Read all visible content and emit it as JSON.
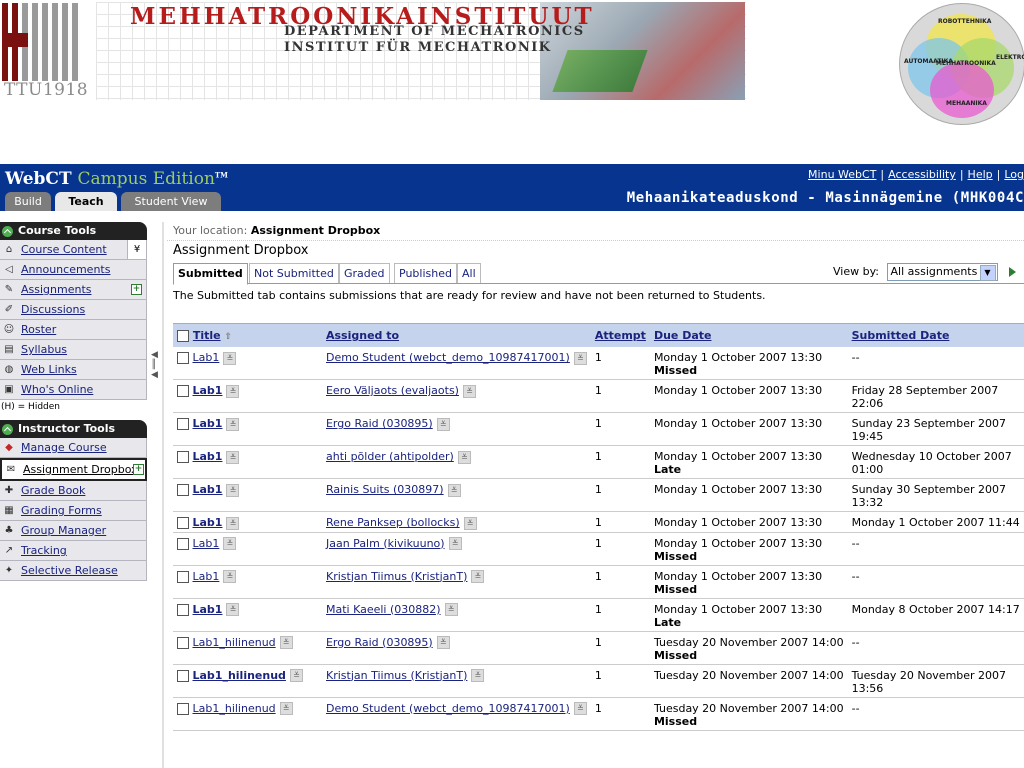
{
  "banner": {
    "ttu": "TTU1918",
    "title": "MEHHATROONIKAINSTITUUT",
    "sub1": "DEPARTMENT OF MECHATRONICS",
    "sub2": "INSTITUT FÜR MECHATRONIK",
    "venn": {
      "top": "ROBOTTEHNIKA",
      "left": "AUTOMAATIKA",
      "right": "ELEKTRONIKA",
      "center": "MEHHATROONIKA",
      "bottom": "MEHAANIKA"
    }
  },
  "header": {
    "logo_main": "WebCT",
    "logo_edition": "Campus Edition",
    "logo_tm": "TM",
    "links": [
      "Minu WebCT",
      "Accessibility",
      "Help",
      "Log"
    ],
    "course_title": "Mehaanikateaduskond - Masinnägemine (MHK004C",
    "tabs": [
      "Build",
      "Teach",
      "Student View"
    ]
  },
  "sidebar": {
    "course_tools_title": "Course Tools",
    "course_tools": [
      {
        "label": "Course Content",
        "icon": "home-icon"
      },
      {
        "label": "Announcements",
        "icon": "megaphone-icon"
      },
      {
        "label": "Assignments",
        "icon": "assignment-icon"
      },
      {
        "label": "Discussions",
        "icon": "discussion-icon"
      },
      {
        "label": "Roster",
        "icon": "roster-icon"
      },
      {
        "label": "Syllabus",
        "icon": "syllabus-icon"
      },
      {
        "label": "Web Links",
        "icon": "globe-icon"
      },
      {
        "label": "Who's Online",
        "icon": "person-icon"
      }
    ],
    "hidden_note": "(H) = Hidden",
    "instructor_tools_title": "Instructor Tools",
    "instructor_tools": [
      {
        "label": "Manage Course",
        "icon": "manage-icon"
      },
      {
        "label": "Assignment Dropbox",
        "icon": "dropbox-icon"
      },
      {
        "label": "Grade Book",
        "icon": "gradebook-icon"
      },
      {
        "label": "Grading Forms",
        "icon": "grading-forms-icon"
      },
      {
        "label": "Group Manager",
        "icon": "group-icon"
      },
      {
        "label": "Tracking",
        "icon": "tracking-icon"
      },
      {
        "label": "Selective Release",
        "icon": "release-icon"
      }
    ]
  },
  "main": {
    "location_label": "Your location:",
    "location_value": "Assignment Dropbox",
    "page_title": "Assignment Dropbox",
    "subtabs": [
      "Submitted",
      "Not Submitted",
      "Graded",
      "Published",
      "All"
    ],
    "viewby_label": "View by:",
    "viewby_value": "All assignments",
    "description": "The Submitted tab contains submissions that are ready for review and have not been returned to Students.",
    "columns": [
      "Title",
      "Assigned to",
      "Attempt",
      "Due Date",
      "Submitted Date"
    ],
    "rows": [
      {
        "title": "Lab1",
        "bold": false,
        "assigned": "Demo Student (webct_demo_10987417001)",
        "attempt": "1",
        "due": "Monday 1 October 2007 13:30",
        "status": "Missed",
        "submitted": "--"
      },
      {
        "title": "Lab1",
        "bold": true,
        "assigned": "Eero Väljaots (evaljaots)",
        "attempt": "1",
        "due": "Monday 1 October 2007 13:30",
        "status": "",
        "submitted": "Friday 28 September 2007 22:06"
      },
      {
        "title": "Lab1",
        "bold": true,
        "assigned": "Ergo Raid (030895)",
        "attempt": "1",
        "due": "Monday 1 October 2007 13:30",
        "status": "",
        "submitted": "Sunday 23 September 2007 19:45"
      },
      {
        "title": "Lab1",
        "bold": true,
        "assigned": "ahti põlder (ahtipolder)",
        "attempt": "1",
        "due": "Monday 1 October 2007 13:30",
        "status": "Late",
        "submitted": "Wednesday 10 October 2007 01:00"
      },
      {
        "title": "Lab1",
        "bold": true,
        "assigned": "Rainis Suits (030897)",
        "attempt": "1",
        "due": "Monday 1 October 2007 13:30",
        "status": "",
        "submitted": "Sunday 30 September 2007 13:32"
      },
      {
        "title": "Lab1",
        "bold": true,
        "assigned": "Rene Panksep (bollocks)",
        "attempt": "1",
        "due": "Monday 1 October 2007 13:30",
        "status": "",
        "submitted": "Monday 1 October 2007 11:44"
      },
      {
        "title": "Lab1",
        "bold": false,
        "assigned": "Jaan Palm (kivikuuno)",
        "attempt": "1",
        "due": "Monday 1 October 2007 13:30",
        "status": "Missed",
        "submitted": "--"
      },
      {
        "title": "Lab1",
        "bold": false,
        "assigned": "Kristjan Tiimus (KristjanT)",
        "attempt": "1",
        "due": "Monday 1 October 2007 13:30",
        "status": "Missed",
        "submitted": "--"
      },
      {
        "title": "Lab1",
        "bold": true,
        "assigned": "Mati Kaeeli (030882)",
        "attempt": "1",
        "due": "Monday 1 October 2007 13:30",
        "status": "Late",
        "submitted": "Monday 8 October 2007 14:17"
      },
      {
        "title": "Lab1_hilinenud",
        "bold": false,
        "assigned": "Ergo Raid (030895)",
        "attempt": "1",
        "due": "Tuesday 20 November 2007 14:00",
        "status": "Missed",
        "submitted": "--"
      },
      {
        "title": "Lab1_hilinenud",
        "bold": true,
        "assigned": "Kristjan Tiimus (KristjanT)",
        "attempt": "1",
        "due": "Tuesday 20 November 2007 14:00",
        "status": "",
        "submitted": "Tuesday 20 November 2007 13:56"
      },
      {
        "title": "Lab1_hilinenud",
        "bold": false,
        "assigned": "Demo Student (webct_demo_10987417001)",
        "attempt": "1",
        "due": "Tuesday 20 November 2007 14:00",
        "status": "Missed",
        "submitted": "--"
      }
    ]
  },
  "colors": {
    "header_blue": "#06348f",
    "table_header": "#c6d3ec",
    "brand_red": "#b71c1c"
  }
}
